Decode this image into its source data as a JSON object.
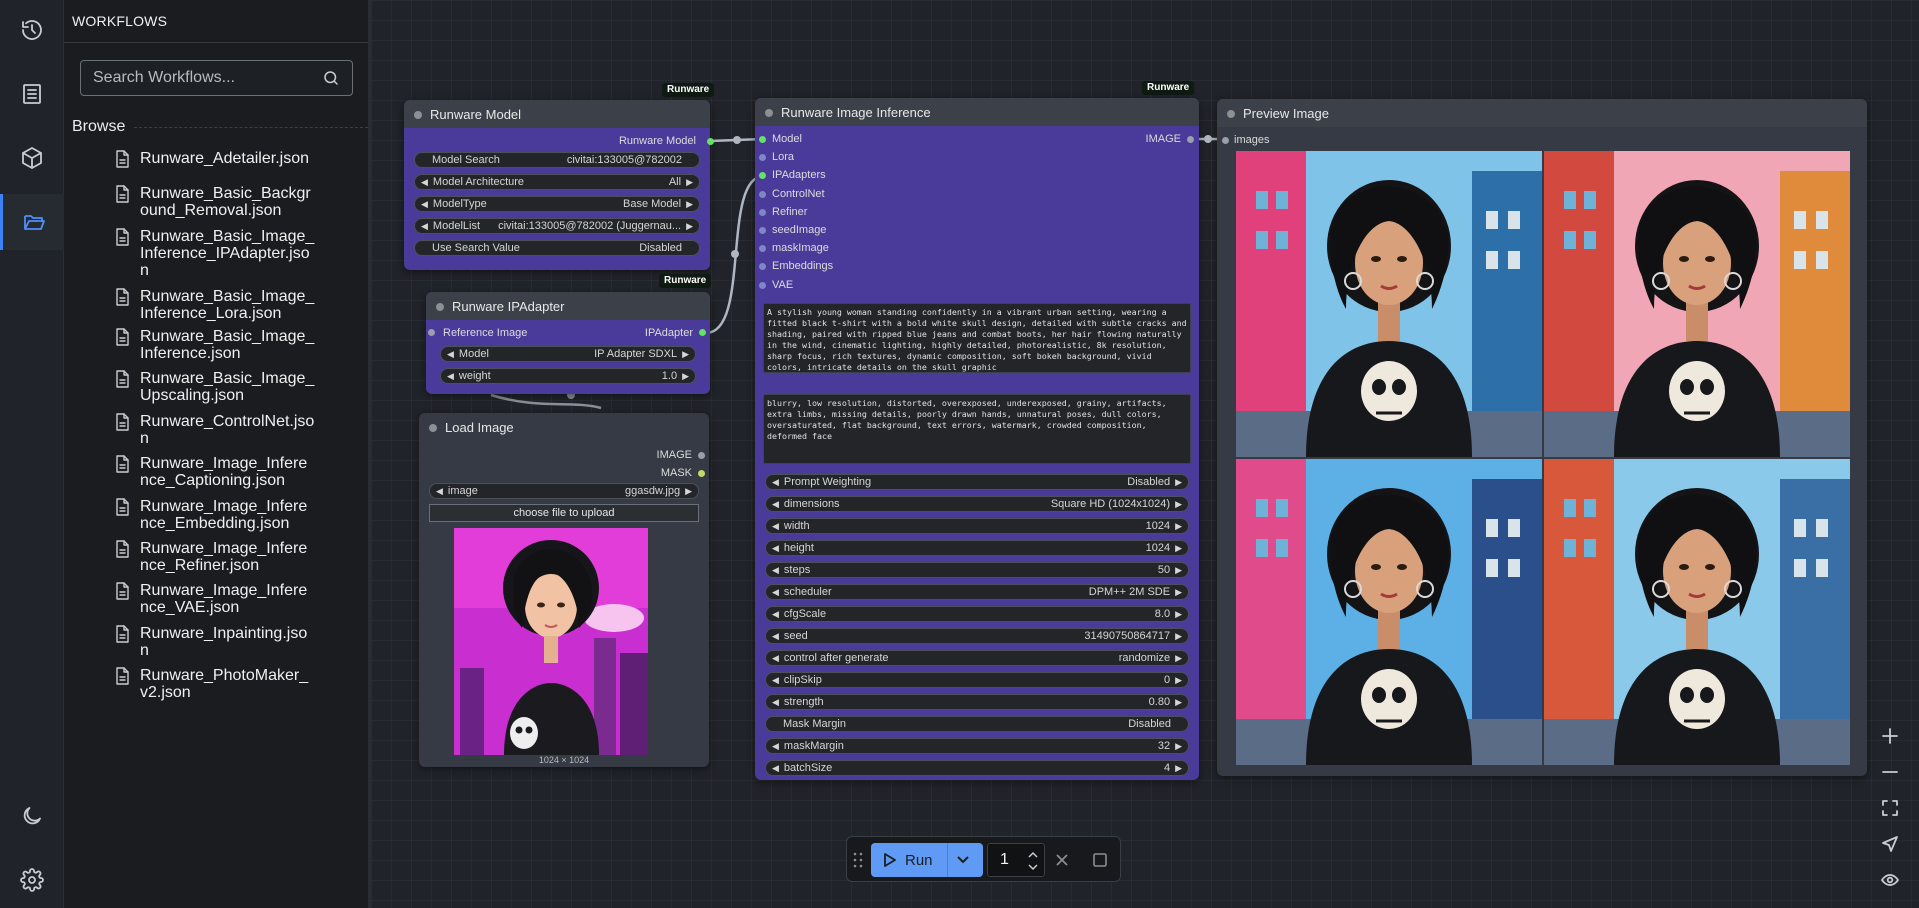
{
  "panel": {
    "title": "WORKFLOWS",
    "search_placeholder": "Search Workflows...",
    "browse_label": "Browse",
    "files": [
      "Runware_Adetailer.json",
      "Runware_Basic_Background_Removal.json",
      "Runware_Basic_Image_Inference_IPAdapter.json",
      "Runware_Basic_Image_Inference_Lora.json",
      "Runware_Basic_Image_Inference.json",
      "Runware_Basic_Image_Upscaling.json",
      "Runware_ControlNet.json",
      "Runware_Image_Inference_Captioning.json",
      "Runware_Image_Inference_Embedding.json",
      "Runware_Image_Inference_Refiner.json",
      "Runware_Image_Inference_VAE.json",
      "Runware_Inpainting.json",
      "Runware_PhotoMaker_v2.json"
    ]
  },
  "rail": {
    "icons": [
      "history-icon",
      "document-icon",
      "cube-icon",
      "folder-open-icon",
      "moon-icon",
      "gear-icon"
    ]
  },
  "nodes": {
    "model": {
      "title": "Runware Model",
      "badge": "Runware",
      "output": "Runware Model",
      "widgets": [
        {
          "label": "Model Search",
          "value": "civitai:133005@782002",
          "arrows": false
        },
        {
          "label": "Model Architecture",
          "value": "All",
          "arrows": true
        },
        {
          "label": "ModelType",
          "value": "Base Model",
          "arrows": true
        },
        {
          "label": "ModelList",
          "value": "civitai:133005@782002 (Juggernau...",
          "arrows": true
        },
        {
          "label": "Use Search Value",
          "value": "Disabled",
          "arrows": false
        }
      ]
    },
    "ipadapter": {
      "title": "Runware IPAdapter",
      "badge": "Runware",
      "input": "Reference Image",
      "output": "IPAdapter",
      "widgets": [
        {
          "label": "Model",
          "value": "IP Adapter SDXL",
          "arrows": true
        },
        {
          "label": "weight",
          "value": "1.0",
          "arrows": true
        }
      ]
    },
    "load_image": {
      "title": "Load Image",
      "outputs": [
        "IMAGE",
        "MASK"
      ],
      "widget": {
        "label": "image",
        "value": "ggasdw.jpg"
      },
      "upload_label": "choose file to upload",
      "dims": "1024 × 1024"
    },
    "inference": {
      "title": "Runware Image Inference",
      "badge": "Runware",
      "inputs": [
        "Model",
        "Lora",
        "IPAdapters",
        "ControlNet",
        "Refiner",
        "seedImage",
        "maskImage",
        "Embeddings",
        "VAE"
      ],
      "output": "IMAGE",
      "positive_prompt": "A stylish young woman standing confidently in a vibrant urban setting, wearing a fitted black t-shirt with a bold white skull design, detailed with subtle cracks and shading, paired with ripped blue jeans and combat boots, her hair flowing naturally in the wind, cinematic lighting, highly detailed, photorealistic, 8k resolution, sharp focus, rich textures, dynamic composition, soft bokeh background, vivid colors, intricate details on the skull graphic",
      "negative_prompt": "blurry, low resolution, distorted, overexposed, underexposed, grainy, artifacts, extra limbs, missing details, poorly drawn hands, unnatural poses, dull colors, oversaturated, flat background, text errors, watermark, crowded composition, deformed face",
      "widgets": [
        {
          "label": "Prompt Weighting",
          "value": "Disabled",
          "arrows": true
        },
        {
          "label": "dimensions",
          "value": "Square HD (1024x1024)",
          "arrows": true
        },
        {
          "label": "width",
          "value": "1024",
          "arrows": true
        },
        {
          "label": "height",
          "value": "1024",
          "arrows": true
        },
        {
          "label": "steps",
          "value": "50",
          "arrows": true
        },
        {
          "label": "scheduler",
          "value": "DPM++ 2M SDE",
          "arrows": true
        },
        {
          "label": "cfgScale",
          "value": "8.0",
          "arrows": true
        },
        {
          "label": "seed",
          "value": "31490750864717",
          "arrows": true
        },
        {
          "label": "control after generate",
          "value": "randomize",
          "arrows": true
        },
        {
          "label": "clipSkip",
          "value": "0",
          "arrows": true
        },
        {
          "label": "strength",
          "value": "0.80",
          "arrows": true
        },
        {
          "label": "Mask Margin",
          "value": "Disabled",
          "arrows": false
        },
        {
          "label": "maskMargin",
          "value": "32",
          "arrows": true
        },
        {
          "label": "batchSize",
          "value": "4",
          "arrows": true
        }
      ]
    },
    "preview": {
      "title": "Preview Image",
      "input": "images"
    }
  },
  "runbar": {
    "run_label": "Run",
    "queue_count": "1"
  },
  "colors": {
    "accent": "#5f9bf5",
    "node_purple": "#4a3a9a",
    "socket_green": "#62e362"
  }
}
